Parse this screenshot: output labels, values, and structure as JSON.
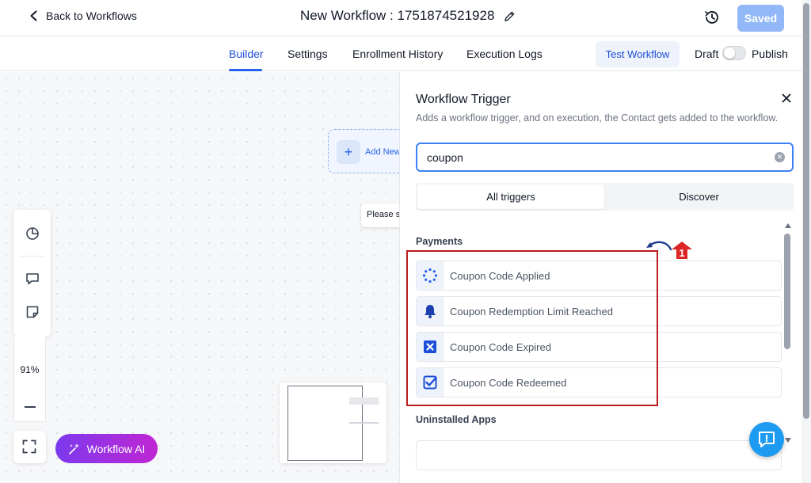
{
  "header": {
    "back_label": "Back to Workflows",
    "workflow_title": "New Workflow : 1751874521928",
    "saved_label": "Saved"
  },
  "nav": {
    "tabs": [
      {
        "label": "Builder",
        "active": true
      },
      {
        "label": "Settings",
        "active": false
      },
      {
        "label": "Enrollment History",
        "active": false
      },
      {
        "label": "Execution Logs",
        "active": false
      }
    ],
    "test_workflow_label": "Test Workflow",
    "draft_label": "Draft",
    "publish_label": "Publish",
    "publish_enabled": false
  },
  "canvas": {
    "add_new_label": "Add New",
    "toast_partial": "Please s",
    "zoom_level": "91%",
    "workflow_ai_label": "Workflow AI"
  },
  "panel": {
    "title": "Workflow Trigger",
    "description": "Adds a workflow trigger, and on execution, the Contact gets added to the workflow.",
    "search_value": "coupon",
    "segments": [
      "All triggers",
      "Discover"
    ],
    "section_payments": "Payments",
    "items": [
      {
        "label": "Coupon Code Applied",
        "icon": "spinner-dots-icon"
      },
      {
        "label": "Coupon Redemption Limit Reached",
        "icon": "bell-icon"
      },
      {
        "label": "Coupon Code Expired",
        "icon": "x-box-icon"
      },
      {
        "label": "Coupon Code Redeemed",
        "icon": "checkbox-icon"
      }
    ],
    "section_uninstalled": "Uninstalled Apps"
  },
  "annotation": {
    "badge_number": "1"
  },
  "colors": {
    "primary": "#2563eb",
    "saved_button": "#93b8f7",
    "highlight_border": "#b91c1c",
    "ai_gradient_start": "#7c3aed",
    "ai_gradient_end": "#c026d3",
    "help_bubble": "#1d9bf0"
  }
}
